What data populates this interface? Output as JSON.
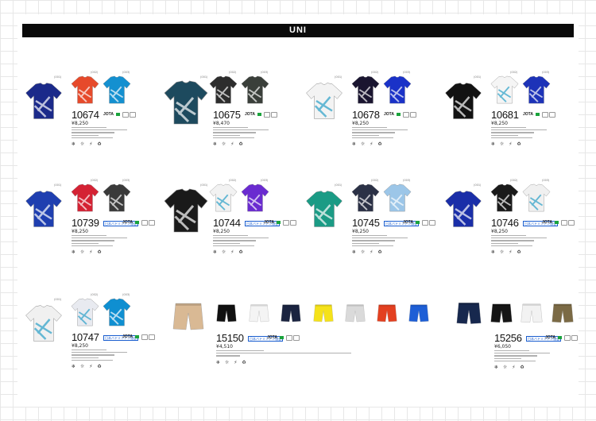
{
  "banner": {
    "title": "UNI"
  },
  "products": [
    {
      "code": "10674",
      "price": "¥8,250",
      "jp_badge": false,
      "colors": [
        "#1b2a8a",
        "#e64a2b",
        "#1490d0"
      ]
    },
    {
      "code": "10675",
      "price": "¥8,470",
      "jp_badge": false,
      "colors": [
        "#1d4a5e",
        "#2d2d2d",
        "#3a3f3a"
      ]
    },
    {
      "code": "10678",
      "price": "¥8,250",
      "jp_badge": false,
      "colors": [
        "#f3f3f3",
        "#1a1530",
        "#1a32c8"
      ]
    },
    {
      "code": "10681",
      "price": "¥8,250",
      "jp_badge": false,
      "colors": [
        "#121212",
        "#f5f5f5",
        "#1d33b8"
      ]
    },
    {
      "code": "10739",
      "price": "¥8,250",
      "jp_badge": true,
      "colors": [
        "#1f3fb0",
        "#d42234",
        "#3a3a3a"
      ]
    },
    {
      "code": "10744",
      "price": "¥8,250",
      "jp_badge": true,
      "colors": [
        "#1a1a1a",
        "#f2f2f2",
        "#6a2bd0"
      ]
    },
    {
      "code": "10745",
      "price": "¥8,250",
      "jp_badge": true,
      "colors": [
        "#1b9b85",
        "#2b3146",
        "#9cc6e8"
      ]
    },
    {
      "code": "10746",
      "price": "¥8,250",
      "jp_badge": true,
      "colors": [
        "#1a2ea8",
        "#1a1a1a",
        "#f0f0f0"
      ]
    },
    {
      "code": "10747",
      "price": "¥8,250",
      "jp_badge": true,
      "colors": [
        "#f0f0f0",
        "#e8eaf0",
        "#0f8fd1"
      ]
    },
    {
      "code": "15150",
      "price": "¥4,510",
      "jp_badge": true,
      "colors": [
        "#d9b994",
        "#111111",
        "#f4f4f4",
        "#1b2440",
        "#f5e21a",
        "#dadada",
        "#e34020",
        "#1e5fd6"
      ]
    },
    {
      "code": "15256",
      "price": "¥6,050",
      "jp_badge": true,
      "colors": [
        "#17284e",
        "#151515",
        "#f2f2f2",
        "#7b6a45"
      ]
    }
  ],
  "brand_mark": "JOTA",
  "badge_label": "日本バドミントン協会審査合格品",
  "icon_row": "❄ ☼ ⚡ ♻"
}
